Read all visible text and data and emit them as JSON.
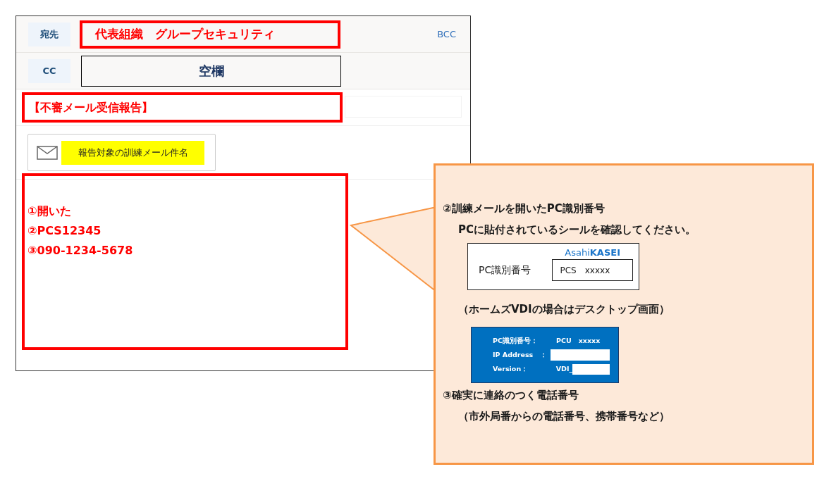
{
  "recipients": [
    {
      "label": "宛先",
      "value": "代表組織　グループセキュリティ",
      "highlighted": true
    },
    {
      "label": "CC",
      "value": "空欄",
      "highlighted": false
    }
  ],
  "bcc_link": "BCC",
  "subject": {
    "value": "【不審メール受信報告】",
    "highlighted": true
  },
  "attachment": {
    "name": "報告対象の訓練メール件名"
  },
  "body": {
    "highlighted": true,
    "lines": [
      "①開いた",
      "②PCS12345",
      "③090-1234-5678"
    ]
  },
  "callout": {
    "items": [
      {
        "kind": "heading",
        "text": "②訓練メールを開いたPC識別番号"
      },
      {
        "kind": "note",
        "text": "PCに貼付されているシールを確認してください。"
      },
      {
        "kind": "sticker",
        "logo": "Asahi**KASEI**",
        "label": "PC識別番号",
        "value": "PCS　xxxxx"
      },
      {
        "kind": "note",
        "text": "（ホームズVDIの場合はデスクトップ画面）"
      },
      {
        "kind": "screen",
        "rows": [
          {
            "label": "PC識別番号：",
            "value": "PCU　xxxxx"
          },
          {
            "label": "IP Address　：",
            "blank": true
          },
          {
            "label": "Version：",
            "value": "VDI_",
            "blank": true
          }
        ]
      },
      {
        "kind": "heading",
        "text": "③確実に連絡のつく電話番号"
      },
      {
        "kind": "note",
        "text": "（市外局番からの電話番号、携帯番号など）"
      }
    ]
  }
}
